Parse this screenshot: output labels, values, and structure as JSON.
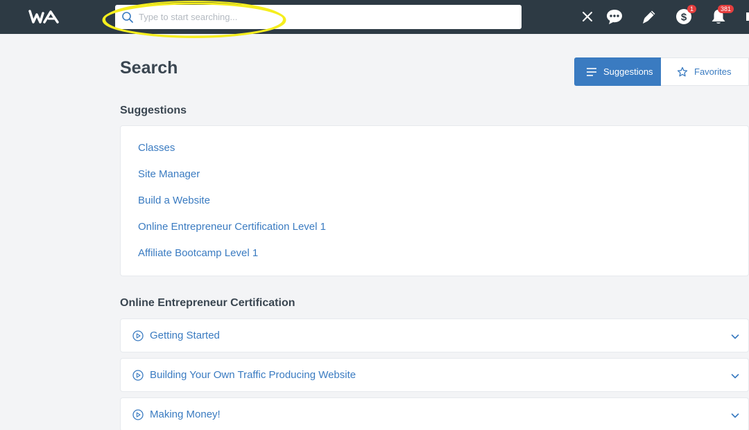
{
  "header": {
    "logo_text": "WA",
    "search": {
      "placeholder": "Type to start searching...",
      "value": ""
    },
    "icons": [
      "close-icon",
      "chat-icon",
      "pencil-icon",
      "dollar-icon",
      "bell-icon"
    ],
    "badges": {
      "earnings": "1",
      "notifications": "381"
    }
  },
  "page": {
    "title": "Search",
    "tabs": [
      {
        "label": "Suggestions",
        "active": true
      },
      {
        "label": "Favorites",
        "active": false
      }
    ]
  },
  "suggestions": {
    "title": "Suggestions",
    "items": [
      "Classes",
      "Site Manager",
      "Build a Website",
      "Online Entrepreneur Certification Level 1",
      "Affiliate Bootcamp Level 1"
    ]
  },
  "certification": {
    "title": "Online Entrepreneur Certification",
    "items": [
      "Getting Started",
      "Building Your Own Traffic Producing Website",
      "Making Money!"
    ]
  },
  "colors": {
    "topbar": "#2d3a44",
    "accent": "#3a7bc1",
    "highlight": "#f5ee1e",
    "badge": "#e53e3e"
  }
}
